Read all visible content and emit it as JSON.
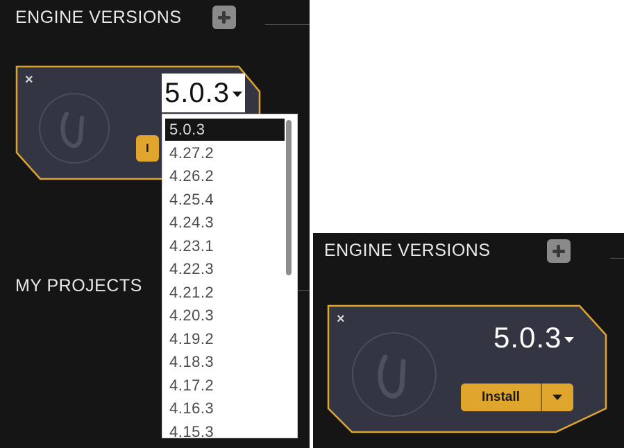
{
  "engine_versions_title": "ENGINE VERSIONS",
  "my_projects_title": "MY PROJECTS",
  "selected_version": "5.0.3",
  "install_label": "Install",
  "close_symbol": "×",
  "dropdown_options": [
    "5.0.3",
    "4.27.2",
    "4.26.2",
    "4.25.4",
    "4.24.3",
    "4.23.1",
    "4.22.3",
    "4.21.2",
    "4.20.3",
    "4.19.2",
    "4.18.3",
    "4.17.2",
    "4.16.3",
    "4.15.3"
  ],
  "colors": {
    "accent": "#e0a52d",
    "panel_bg": "#151515",
    "card_bg": "#333642"
  },
  "icons": [
    "plus-icon",
    "close-icon",
    "unreal-logo-icon",
    "chevron-down-icon"
  ]
}
